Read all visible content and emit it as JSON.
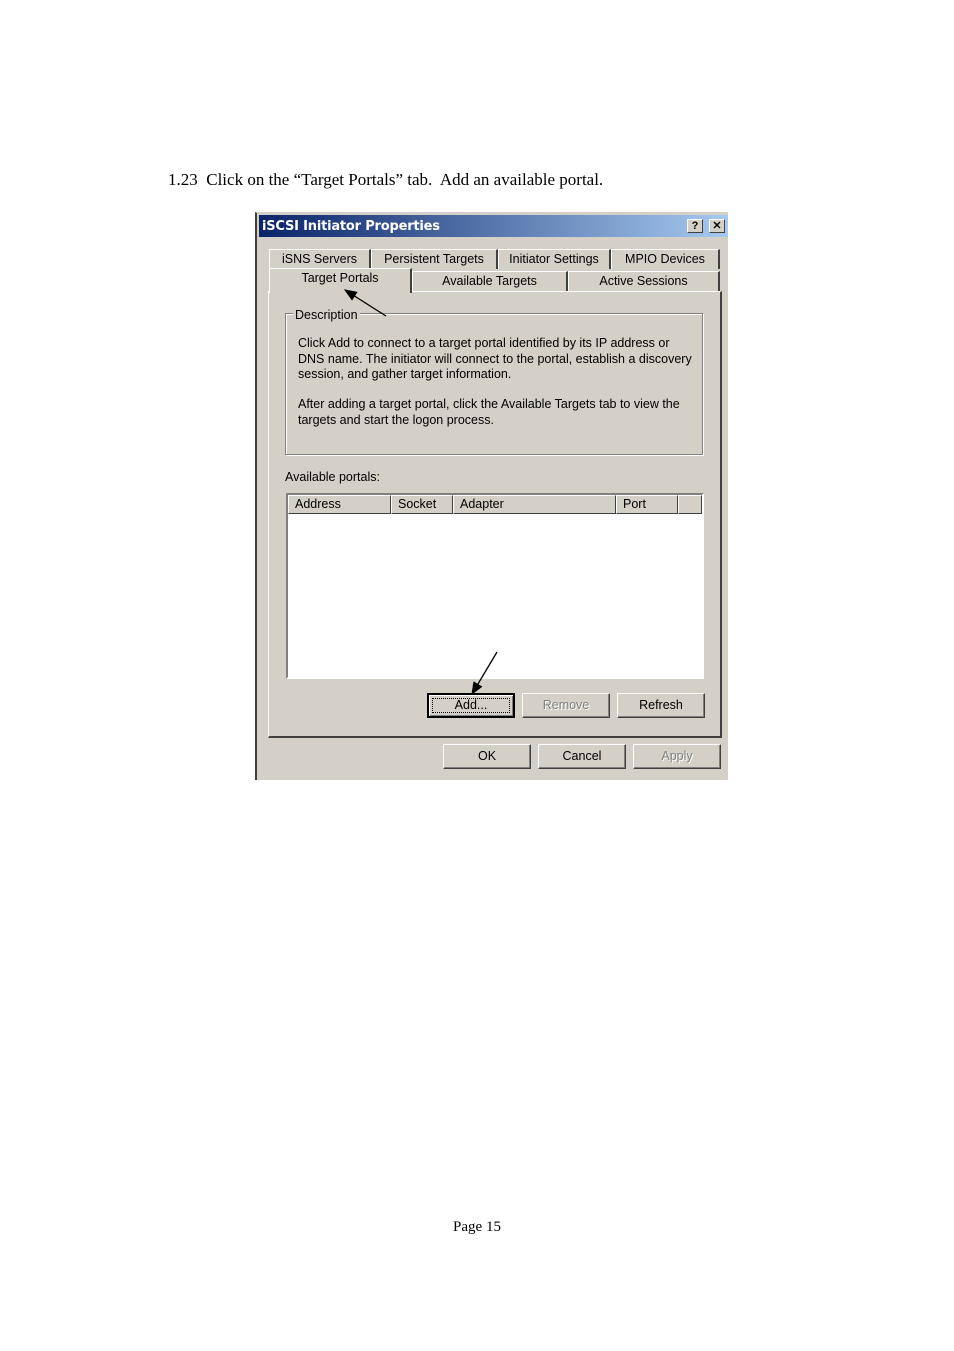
{
  "document": {
    "step_text": "1.23  Click on the “Target Portals” tab.  Add an available portal.",
    "page_number": "Page 15"
  },
  "window": {
    "title": "iSCSI Initiator Properties",
    "help_glyph": "?",
    "close_glyph": "✕"
  },
  "tabs": {
    "row1": [
      "iSNS Servers",
      "Persistent Targets",
      "Initiator Settings",
      "MPIO Devices"
    ],
    "row2": [
      "Target Portals",
      "Available Targets",
      "Active Sessions"
    ],
    "active": "Target Portals"
  },
  "description": {
    "label": "Description",
    "lines1": [
      "Click Add to connect to a target portal identified by its IP address or",
      "DNS name. The initiator will connect to the portal, establish a discovery",
      "session, and gather target information."
    ],
    "lines2": [
      "After adding a target portal, click the Available Targets tab to view the",
      "targets and start the logon process."
    ]
  },
  "portals": {
    "label": "Available portals:",
    "columns": [
      "Address",
      "Socket",
      "Adapter",
      "Port"
    ],
    "rows": []
  },
  "buttons": {
    "add": "Add...",
    "remove": "Remove",
    "refresh": "Refresh",
    "ok": "OK",
    "cancel": "Cancel",
    "apply": "Apply"
  }
}
